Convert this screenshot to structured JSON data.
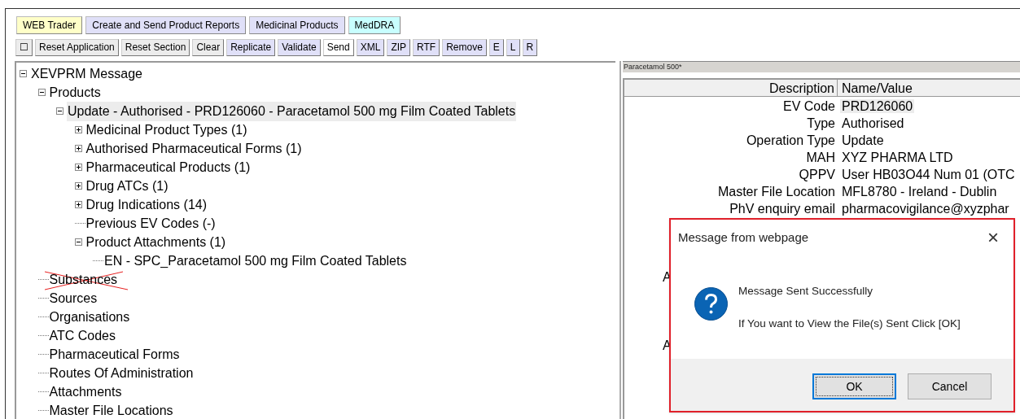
{
  "tabs": [
    {
      "label": "WEB Trader",
      "color": "#ffffc8"
    },
    {
      "label": "Create and Send Product Reports",
      "color": "#e0e0f8"
    },
    {
      "label": "Medicinal Products",
      "color": "#e0e0f8"
    },
    {
      "label": "MedDRA",
      "color": "#c8ffff"
    }
  ],
  "toolbar": [
    {
      "label": "☐",
      "color": "#ececec"
    },
    {
      "label": "Reset Application",
      "color": "#ececec"
    },
    {
      "label": "Reset Section",
      "color": "#ececec"
    },
    {
      "label": "Clear",
      "color": "#ececec"
    },
    {
      "label": "Replicate",
      "color": "#e0e0f8"
    },
    {
      "label": "Validate",
      "color": "#e0e0f8"
    },
    {
      "label": "Send",
      "color": "#ffffff"
    },
    {
      "label": "XML",
      "color": "#e0e0f8"
    },
    {
      "label": "ZIP",
      "color": "#e0e0f8"
    },
    {
      "label": "RTF",
      "color": "#e0e0f8"
    },
    {
      "label": "Remove",
      "color": "#e0e0f8"
    },
    {
      "label": "E",
      "color": "#e0e0f8"
    },
    {
      "label": "L",
      "color": "#e0e0f8"
    },
    {
      "label": "R",
      "color": "#e0e0f8"
    }
  ],
  "tree": [
    {
      "label": "XEVPRM Message",
      "expanded": true,
      "selected": false,
      "children": [
        {
          "label": "Products",
          "expanded": true,
          "selected": false,
          "children": [
            {
              "label": "Update - Authorised - PRD126060 - Paracetamol 500 mg Film Coated Tablets",
              "expanded": true,
              "selected": true,
              "children": [
                {
                  "label": "Medicinal Product Types (1)",
                  "expanded": false,
                  "selected": false
                },
                {
                  "label": "Authorised Pharmaceutical Forms (1)",
                  "expanded": false,
                  "selected": false
                },
                {
                  "label": "Pharmaceutical Products (1)",
                  "expanded": false,
                  "selected": false
                },
                {
                  "label": "Drug ATCs (1)",
                  "expanded": false,
                  "selected": false
                },
                {
                  "label": "Drug Indications (14)",
                  "expanded": false,
                  "selected": false
                },
                {
                  "label": "Previous EV Codes (-)",
                  "selected": false
                },
                {
                  "label": "Product Attachments (1)",
                  "expanded": true,
                  "selected": false,
                  "children": [
                    {
                      "label": "EN - SPC_Paracetamol 500 mg Film Coated Tablets",
                      "selected": false
                    }
                  ]
                }
              ]
            }
          ]
        },
        {
          "label": "Substances",
          "selected": false
        },
        {
          "label": "Sources",
          "selected": false
        },
        {
          "label": "Organisations",
          "selected": false
        },
        {
          "label": "ATC Codes",
          "selected": false
        },
        {
          "label": "Pharmaceutical Forms",
          "selected": false
        },
        {
          "label": "Routes Of Administration",
          "selected": false
        },
        {
          "label": "Attachments",
          "selected": false
        },
        {
          "label": "Master File Locations",
          "selected": false
        }
      ]
    }
  ],
  "detail": {
    "title": "Paracetamol 500*",
    "columns": [
      "Description",
      "Name/Value"
    ],
    "rows": [
      {
        "description": "EV Code",
        "value": "PRD126060",
        "selected": true
      },
      {
        "description": "Type",
        "value": "Authorised",
        "selected": false
      },
      {
        "description": "Operation Type",
        "value": "Update",
        "selected": false
      },
      {
        "description": "MAH",
        "value": "XYZ PHARMA LTD",
        "selected": false
      },
      {
        "description": "QPPV",
        "value": "User HB03O44 Num 01 (OTC",
        "selected": false
      },
      {
        "description": "Master File Location",
        "value": "MFL8780 - Ireland - Dublin",
        "selected": false
      },
      {
        "description": "PhV enquiry email",
        "value": "pharmacovigilance@xyzphar",
        "selected": false
      }
    ],
    "partial_rows": [
      {
        "description": "A"
      },
      {
        "description": "A"
      }
    ]
  },
  "dialog": {
    "title": "Message from webpage",
    "close": "×",
    "lines": [
      "Message Sent Successfully",
      "If You want to View the File(s) Sent Click [OK]"
    ],
    "buttons": [
      {
        "label": "OK",
        "selected": true
      },
      {
        "label": "Cancel",
        "selected": false
      }
    ]
  }
}
